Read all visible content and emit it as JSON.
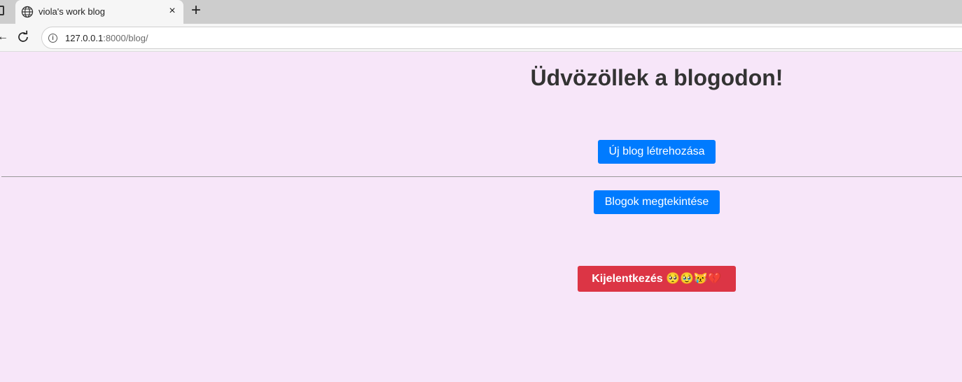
{
  "browser": {
    "tab_title": "viola's work blog",
    "tab_close_glyph": "×",
    "new_tab_glyph": "+",
    "back_glyph": "←",
    "url_host": "127.0.0.1",
    "url_rest": ":8000/blog/",
    "icons": [
      "window-icon",
      "globe-icon",
      "close-icon",
      "plus-icon",
      "back-icon",
      "reload-icon",
      "info-icon"
    ]
  },
  "page": {
    "heading": "Üdvözöllek a blogodon!",
    "new_blog_label": "Új blog létrehozása",
    "view_blogs_label": "Blogok megtekintése",
    "logout_label": "Kijelentkezés 🥺🥹😿💔",
    "colors": {
      "background": "#f7e6f9",
      "primary": "#007bff",
      "danger": "#dc3545"
    }
  }
}
